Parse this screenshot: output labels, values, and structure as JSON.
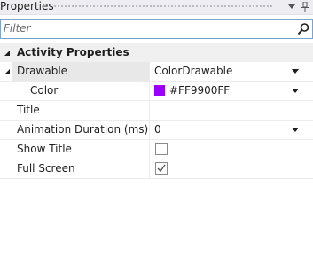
{
  "panel": {
    "title": "Properties",
    "dropdown_icon": "chevron-down-icon",
    "pin_icon": "pin-icon"
  },
  "filter": {
    "placeholder": "Filter",
    "value": "",
    "icon": "search-icon"
  },
  "category": {
    "label": "Activity Properties",
    "expanded": true
  },
  "properties": [
    {
      "name": "Drawable",
      "value": "ColorDrawable",
      "editor": "dropdown",
      "expanded": true
    },
    {
      "name": "Color",
      "value": "#FF9900FF",
      "editor": "dropdown",
      "swatch": "#9900FF"
    },
    {
      "name": "Title",
      "value": "",
      "editor": "text"
    },
    {
      "name": "Animation Duration (ms)",
      "value": "0",
      "editor": "dropdown"
    },
    {
      "name": "Show Title",
      "checked": false,
      "editor": "checkbox"
    },
    {
      "name": "Full Screen",
      "checked": true,
      "editor": "checkbox"
    }
  ],
  "colors": {
    "accent_border": "#7aa3cf",
    "category_bg": "#f0f0f0",
    "selected_bg": "#e8e8e8"
  }
}
